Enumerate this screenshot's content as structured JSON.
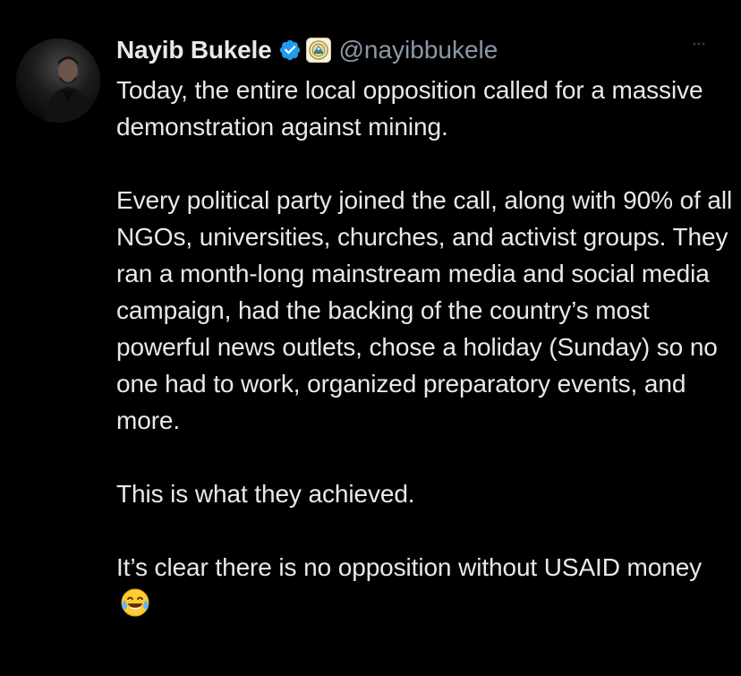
{
  "tweet": {
    "author": {
      "display_name": "Nayib Bukele",
      "handle": "@nayibbukele",
      "avatar_icon": "profile-photo",
      "verified_icon": "verified-badge-icon",
      "affiliation_icon": "government-seal-icon"
    },
    "paragraphs": [
      "Today, the entire local opposition called for a massive demonstration against mining.",
      "Every political party joined the call, along with 90% of all NGOs, universities, churches, and activist groups. They ran a month-long mainstream media and social media campaign, had the backing of the country’s most powerful news outlets, chose a holiday (Sunday) so no one had to work, organized preparatory events, and more.",
      "This is what they achieved.",
      "It’s clear there is no opposition without USAID money"
    ],
    "trailing_emoji": "face-with-tears-of-joy-icon"
  },
  "colors": {
    "background": "#000000",
    "text": "#e7e9ea",
    "secondary_text": "#8b98a5",
    "verified_blue": "#1d9bf0"
  }
}
